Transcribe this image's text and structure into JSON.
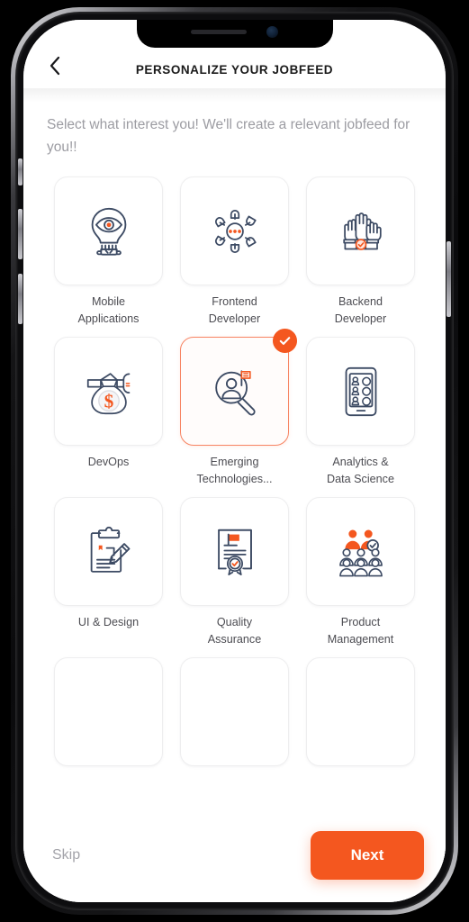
{
  "header": {
    "title": "PERSONALIZE YOUR JOBFEED",
    "back_icon": "chevron-left-icon"
  },
  "intro": {
    "text": "Select what interest you! We'll create a relevant jobfeed for you!!"
  },
  "colors": {
    "accent": "#f4571f",
    "accent_border": "#f78463",
    "icon_stroke": "#3c4a63",
    "label": "#4c4c52",
    "muted": "#9c9ca2"
  },
  "grid": {
    "items": [
      {
        "label": "Mobile\nApplications",
        "icon": "lightbulb-eye-icon",
        "selected": false
      },
      {
        "label": "Frontend\nDeveloper",
        "icon": "network-hub-icon",
        "selected": false
      },
      {
        "label": "Backend\nDeveloper",
        "icon": "raised-hands-icon",
        "selected": false
      },
      {
        "label": "DevOps",
        "icon": "money-bag-icon",
        "selected": false
      },
      {
        "label": "Emerging\nTechnologies...",
        "icon": "candidate-search-icon",
        "selected": true
      },
      {
        "label": "Analytics &\nData Science",
        "icon": "tablet-list-icon",
        "selected": false
      },
      {
        "label": "UI & Design",
        "icon": "clipboard-pencil-icon",
        "selected": false
      },
      {
        "label": "Quality\nAssurance",
        "icon": "certificate-seal-icon",
        "selected": false
      },
      {
        "label": "Product\nManagement",
        "icon": "team-group-icon",
        "selected": false
      }
    ],
    "selected_badge_icon": "check-circle-icon",
    "partial_row_count": 3
  },
  "footer": {
    "skip_label": "Skip",
    "next_label": "Next"
  }
}
